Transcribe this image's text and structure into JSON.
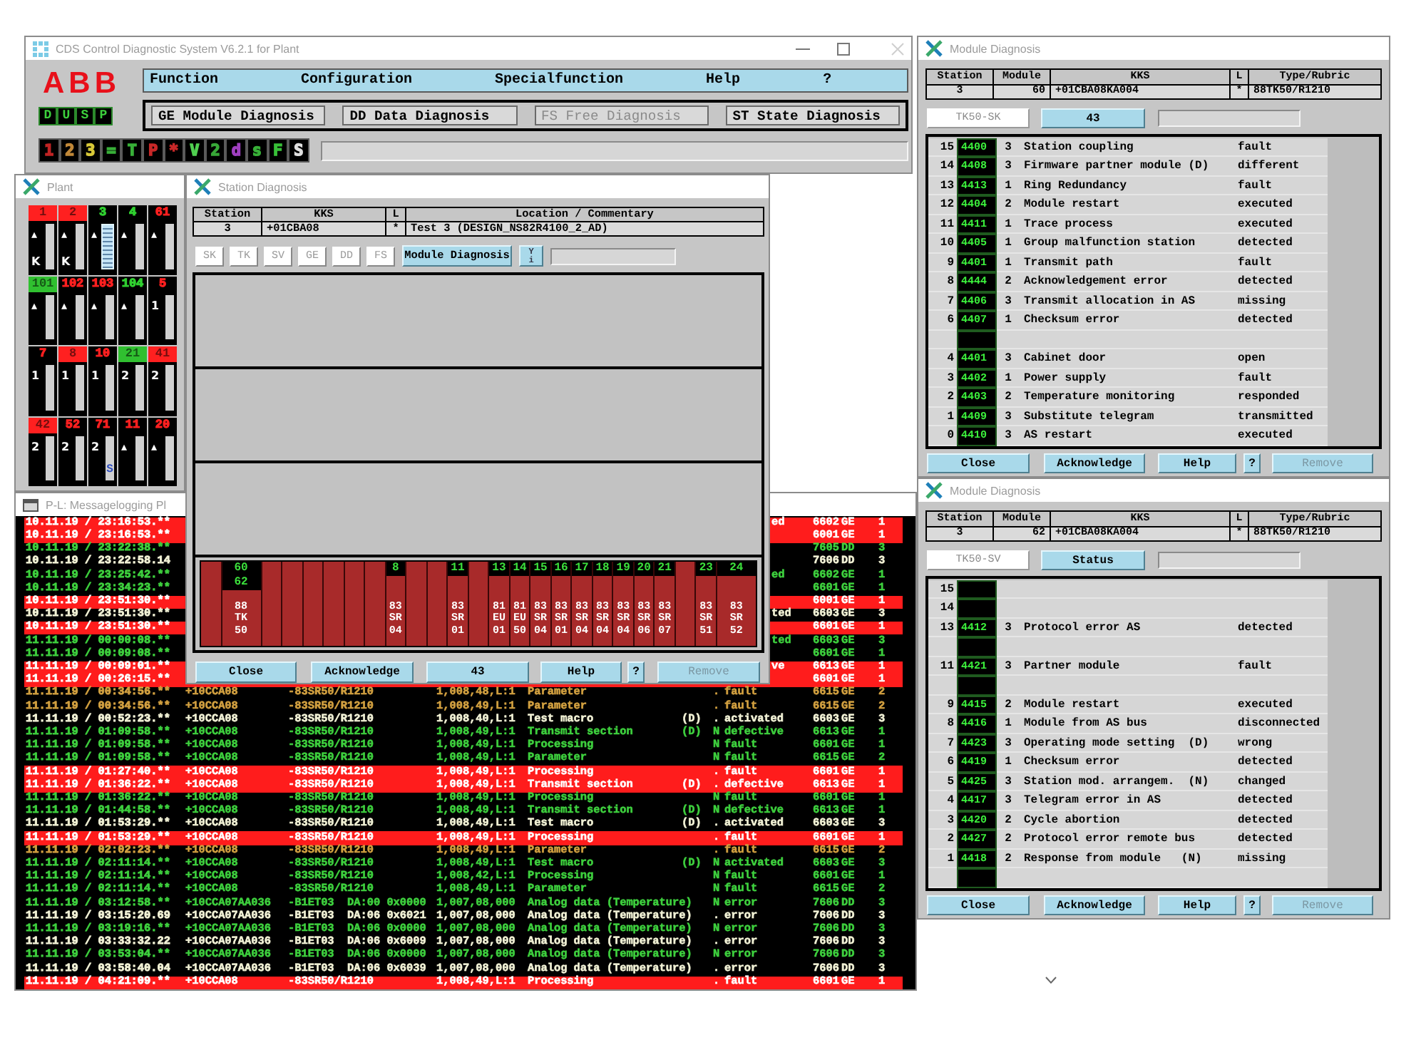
{
  "main_window": {
    "title": "CDS Control Diagnostic System V6.2.1 for Plant",
    "logo": "ABB",
    "mode_keys": [
      "D",
      "U",
      "S",
      "P"
    ],
    "menu": [
      "Function",
      "Configuration",
      "Specialfunction",
      "Help",
      "?"
    ],
    "tabs": [
      {
        "label": "GE Module Diagnosis",
        "disabled": false
      },
      {
        "label": "DD Data Diagnosis",
        "disabled": false
      },
      {
        "label": "FS Free Diagnosis",
        "disabled": true
      },
      {
        "label": "ST State Diagnosis",
        "disabled": false
      }
    ],
    "filter_keys": [
      {
        "label": "1",
        "color": "#c02424"
      },
      {
        "label": "2",
        "color": "#c08838"
      },
      {
        "label": "3",
        "color": "#d8c838"
      },
      {
        "label": "=",
        "color": "#38b038"
      },
      {
        "label": "T",
        "color": "#38b038"
      },
      {
        "label": "P",
        "color": "#c82828"
      },
      {
        "label": "*",
        "color": "#c82828"
      },
      {
        "label": "V",
        "color": "#50d050"
      },
      {
        "label": "2",
        "color": "#38a838"
      },
      {
        "label": "d",
        "color": "#a040c0"
      },
      {
        "label": "s",
        "color": "#38b038"
      },
      {
        "label": "F",
        "color": "#38c038"
      },
      {
        "label": "S",
        "color": "#e0e0e0"
      }
    ]
  },
  "plant_window": {
    "title": "Plant",
    "racks": [
      {
        "label": "1",
        "color": "#ff2020",
        "filled": true,
        "marks": [
          "▴",
          "K"
        ],
        "selected": false
      },
      {
        "label": "2",
        "color": "#ff2020",
        "filled": true,
        "marks": [
          "▴",
          "K"
        ],
        "selected": false
      },
      {
        "label": "3",
        "color": "#30d030",
        "filled": false,
        "marks": [
          "▴"
        ],
        "selected": true
      },
      {
        "label": "4",
        "color": "#30d030",
        "filled": false,
        "marks": [
          "▴"
        ],
        "selected": false
      },
      {
        "label": "61",
        "color": "#ff2020",
        "filled": false,
        "marks": [
          "▴"
        ],
        "selected": false
      },
      {
        "label": "101",
        "color": "#30c030",
        "filled": true,
        "marks": [
          "▴"
        ],
        "selected": false
      },
      {
        "label": "102",
        "color": "#ff2020",
        "filled": false,
        "marks": [
          "▴"
        ],
        "selected": false
      },
      {
        "label": "103",
        "color": "#ff2020",
        "filled": false,
        "marks": [
          "▴"
        ],
        "selected": false
      },
      {
        "label": "104",
        "color": "#30d030",
        "filled": false,
        "marks": [
          "▴"
        ],
        "selected": false
      },
      {
        "label": "5",
        "color": "#ff2020",
        "filled": false,
        "marks": [
          "1"
        ],
        "selected": false
      },
      {
        "label": "7",
        "color": "#ff2020",
        "filled": false,
        "marks": [
          "1"
        ],
        "selected": false
      },
      {
        "label": "8",
        "color": "#ff2020",
        "filled": true,
        "marks": [
          "1"
        ],
        "selected": false
      },
      {
        "label": "10",
        "color": "#ff2020",
        "filled": false,
        "marks": [
          "1"
        ],
        "selected": false
      },
      {
        "label": "21",
        "color": "#30c030",
        "filled": true,
        "marks": [
          "2"
        ],
        "selected": false
      },
      {
        "label": "41",
        "color": "#ff2020",
        "filled": true,
        "marks": [
          "2"
        ],
        "selected": false
      },
      {
        "label": "42",
        "color": "#ff2020",
        "filled": true,
        "marks": [
          "2"
        ],
        "selected": false
      },
      {
        "label": "52",
        "color": "#ff2020",
        "filled": false,
        "marks": [
          "2"
        ],
        "selected": false
      },
      {
        "label": "71",
        "color": "#ff2020",
        "filled": false,
        "marks": [
          "2"
        ],
        "selected": false,
        "bar_label": "S"
      },
      {
        "label": "11",
        "color": "#ff2020",
        "filled": false,
        "marks": [
          "▴"
        ],
        "selected": false
      },
      {
        "label": "20",
        "color": "#ff2020",
        "filled": false,
        "marks": [
          "▴"
        ],
        "selected": false
      }
    ]
  },
  "log_window": {
    "title": "P-L: Messagelogging Pl",
    "rows": [
      {
        "date": "10.11.19 / 23:16:53.**",
        "tail": "ed",
        "code": "6602",
        "type": "GE",
        "priority": "1",
        "color": "#ffffff",
        "highlighted": true
      },
      {
        "date": "10.11.19 / 23:16:53.**",
        "code": "6001",
        "type": "GE",
        "priority": "1",
        "color": "#ffffff",
        "highlighted": true
      },
      {
        "date": "10.11.19 / 23:22:38.**",
        "code": "7605",
        "type": "DD",
        "priority": "3",
        "color": "#3ed03e",
        "highlighted": false
      },
      {
        "date": "10.11.19 / 23:22:58.14",
        "code": "7606",
        "type": "DD",
        "priority": "3",
        "color": "#f2f2d6",
        "highlighted": false
      },
      {
        "date": "10.11.19 / 23:25:42.**",
        "tail": "ed",
        "code": "6602",
        "type": "GE",
        "priority": "1",
        "color": "#3ed03e",
        "highlighted": false
      },
      {
        "date": "10.11.19 / 23:34:23.**",
        "code": "6601",
        "type": "GE",
        "priority": "1",
        "color": "#3ed03e",
        "highlighted": false
      },
      {
        "date": "10.11.19 / 23:51:30.**",
        "code": "6001",
        "type": "GE",
        "priority": "1",
        "color": "#ffffff",
        "highlighted": true
      },
      {
        "date": "10.11.19 / 23:51:30.**",
        "tail": "ted",
        "code": "6603",
        "type": "GE",
        "priority": "3",
        "color": "#f2f2d6",
        "highlighted": false
      },
      {
        "date": "10.11.19 / 23:51:30.**",
        "code": "6601",
        "type": "GE",
        "priority": "1",
        "color": "#ffffff",
        "highlighted": true
      },
      {
        "date": "11.11.19 / 00:00:08.**",
        "tail": "ted",
        "code": "6603",
        "type": "GE",
        "priority": "3",
        "color": "#3ed03e",
        "highlighted": false
      },
      {
        "date": "11.11.19 / 00:09:08.**",
        "code": "6601",
        "type": "GE",
        "priority": "1",
        "color": "#3ed03e",
        "highlighted": false
      },
      {
        "date": "11.11.19 / 00:09:01.**",
        "tail": "ve",
        "code": "6613",
        "type": "GE",
        "priority": "1",
        "color": "#ffffff",
        "highlighted": true
      },
      {
        "date": "11.11.19 / 00:26:15.**",
        "code": "6601",
        "type": "GE",
        "priority": "1",
        "color": "#ffffff",
        "highlighted": true
      },
      {
        "date": "11.11.19 / 00:34:56.**",
        "kks": "+10CCA08",
        "module": "-83SR50/R1210",
        "address": "1,008,48,L:1",
        "text": "Parameter",
        "mark": ".",
        "status": "fault",
        "code": "6615",
        "type": "GE",
        "priority": "2",
        "color": "#d2a040",
        "highlighted": false
      },
      {
        "date": "11.11.19 / 00:34:56.**",
        "kks": "+10CCA08",
        "module": "-83SR50/R1210",
        "address": "1,008,49,L:1",
        "text": "Parameter",
        "mark": ".",
        "status": "fault",
        "code": "6615",
        "type": "GE",
        "priority": "2",
        "color": "#d2a040",
        "highlighted": false
      },
      {
        "date": "11.11.19 / 00:52:23.**",
        "kks": "+10CCA08",
        "module": "-83SR50/R1210",
        "address": "1,008,40,L:1",
        "text": "Test macro",
        "flag": "(D)",
        "mark": ".",
        "status": "activated",
        "code": "6603",
        "type": "GE",
        "priority": "3",
        "color": "#f2f2d6",
        "highlighted": false
      },
      {
        "date": "11.11.19 / 01:09:58.**",
        "kks": "+10CCA08",
        "module": "-83SR50/R1210",
        "address": "1,008,49,L:1",
        "text": "Transmit section",
        "flag": "(D)",
        "mark": "N",
        "status": "defective",
        "code": "6613",
        "type": "GE",
        "priority": "1",
        "color": "#3ed03e",
        "highlighted": false
      },
      {
        "date": "11.11.19 / 01:09:58.**",
        "kks": "+10CCA08",
        "module": "-83SR50/R1210",
        "address": "1,008,49,L:1",
        "text": "Processing",
        "mark": "N",
        "status": "fault",
        "code": "6601",
        "type": "GE",
        "priority": "1",
        "color": "#3ed03e",
        "highlighted": false
      },
      {
        "date": "11.11.19 / 01:09:58.**",
        "kks": "+10CCA08",
        "module": "-83SR50/R1210",
        "address": "1,008,49,L:1",
        "text": "Parameter",
        "mark": "N",
        "status": "fault",
        "code": "6615",
        "type": "GE",
        "priority": "2",
        "color": "#3ed03e",
        "highlighted": false
      },
      {
        "date": "11.11.19 / 01:27:40.**",
        "kks": "+10CCA08",
        "module": "-83SR50/R1210",
        "address": "1,008,49,L:1",
        "text": "Processing",
        "mark": ".",
        "status": "fault",
        "code": "6601",
        "type": "GE",
        "priority": "1",
        "color": "#ffffff",
        "highlighted": true
      },
      {
        "date": "11.11.19 / 01:36:22.**",
        "kks": "+10CCA08",
        "module": "-83SR50/R1210",
        "address": "1,008,49,L:1",
        "text": "Transmit section",
        "flag": "(D)",
        "mark": ".",
        "status": "defective",
        "code": "6613",
        "type": "GE",
        "priority": "1",
        "color": "#ffffff",
        "highlighted": true
      },
      {
        "date": "11.11.19 / 01:36:22.**",
        "kks": "+10CCA08",
        "module": "-83SR50/R1210",
        "address": "1,008,49,L:1",
        "text": "Processing",
        "mark": "N",
        "status": "fault",
        "code": "6601",
        "type": "GE",
        "priority": "1",
        "color": "#3ed03e",
        "highlighted": false
      },
      {
        "date": "11.11.19 / 01:44:58.**",
        "kks": "+10CCA08",
        "module": "-83SR50/R1210",
        "address": "1,008,49,L:1",
        "text": "Transmit section",
        "flag": "(D)",
        "mark": "N",
        "status": "defective",
        "code": "6613",
        "type": "GE",
        "priority": "1",
        "color": "#3ed03e",
        "highlighted": false
      },
      {
        "date": "11.11.19 / 01:53:29.**",
        "kks": "+10CCA08",
        "module": "-83SR50/R1210",
        "address": "1,008,49,L:1",
        "text": "Test macro",
        "flag": "(D)",
        "mark": ".",
        "status": "activated",
        "code": "6603",
        "type": "GE",
        "priority": "3",
        "color": "#f2f2d6",
        "highlighted": false
      },
      {
        "date": "11.11.19 / 01:53:29.**",
        "kks": "+10CCA08",
        "module": "-83SR50/R1210",
        "address": "1,008,49,L:1",
        "text": "Processing",
        "mark": ".",
        "status": "fault",
        "code": "6601",
        "type": "GE",
        "priority": "1",
        "color": "#ffffff",
        "highlighted": true
      },
      {
        "date": "11.11.19 / 02:02:23.**",
        "kks": "+10CCA08",
        "module": "-83SR50/R1210",
        "address": "1,008,49,L:1",
        "text": "Parameter",
        "mark": ".",
        "status": "fault",
        "code": "6615",
        "type": "GE",
        "priority": "2",
        "color": "#d2a040",
        "highlighted": false
      },
      {
        "date": "11.11.19 / 02:11:14.**",
        "kks": "+10CCA08",
        "module": "-83SR50/R1210",
        "address": "1,008,49,L:1",
        "text": "Test macro",
        "flag": "(D)",
        "mark": "N",
        "status": "activated",
        "code": "6603",
        "type": "GE",
        "priority": "3",
        "color": "#3ed03e",
        "highlighted": false
      },
      {
        "date": "11.11.19 / 02:11:14.**",
        "kks": "+10CCA08",
        "module": "-83SR50/R1210",
        "address": "1,008,42,L:1",
        "text": "Processing",
        "mark": "N",
        "status": "fault",
        "code": "6601",
        "type": "GE",
        "priority": "1",
        "color": "#3ed03e",
        "highlighted": false
      },
      {
        "date": "11.11.19 / 02:11:14.**",
        "kks": "+10CCA08",
        "module": "-83SR50/R1210",
        "address": "1,008,49,L:1",
        "text": "Parameter",
        "mark": "N",
        "status": "fault",
        "code": "6615",
        "type": "GE",
        "priority": "2",
        "color": "#3ed03e",
        "highlighted": false
      },
      {
        "date": "11.11.19 / 03:12:58.**",
        "kks": "+10CCA07AA036",
        "module": "-B1ET03  DA:00 0x0000",
        "address": "1,007,08,000",
        "text": "Analog data (Temperature)",
        "mark": "N",
        "status": "error",
        "code": "7606",
        "type": "DD",
        "priority": "3",
        "color": "#3ed03e",
        "highlighted": false
      },
      {
        "date": "11.11.19 / 03:15:20.69",
        "kks": "+10CCA07AA036",
        "module": "-B1ET03  DA:06 0x6021",
        "address": "1,007,08,000",
        "text": "Analog data (Temperature)",
        "mark": ".",
        "status": "error",
        "code": "7606",
        "type": "DD",
        "priority": "3",
        "color": "#f2f2d6",
        "highlighted": false
      },
      {
        "date": "11.11.19 / 03:19:16.**",
        "kks": "+10CCA07AA036",
        "module": "-B1ET03  DA:06 0x0000",
        "address": "1,007,08,000",
        "text": "Analog data (Temperature)",
        "mark": "N",
        "status": "error",
        "code": "7606",
        "type": "DD",
        "priority": "3",
        "color": "#3ed03e",
        "highlighted": false
      },
      {
        "date": "11.11.19 / 03:33:32.22",
        "kks": "+10CCA07AA036",
        "module": "-B1ET03  DA:06 0x6009",
        "address": "1,007,08,000",
        "text": "Analog data (Temperature)",
        "mark": ".",
        "status": "error",
        "code": "7606",
        "type": "DD",
        "priority": "3",
        "color": "#f2f2d6",
        "highlighted": false
      },
      {
        "date": "11.11.19 / 03:53:04.**",
        "kks": "+10CCA07AA036",
        "module": "-B1ET03  DA:06 0x0000",
        "address": "1,007,08,000",
        "text": "Analog data (Temperature)",
        "mark": "N",
        "status": "error",
        "code": "7606",
        "type": "DD",
        "priority": "3",
        "color": "#3ed03e",
        "highlighted": false
      },
      {
        "date": "11.11.19 / 03:58:40.04",
        "kks": "+10CCA07AA036",
        "module": "-B1ET03  DA:06 0x6039",
        "address": "1,007,08,000",
        "text": "Analog data (Temperature)",
        "mark": ".",
        "status": "error",
        "code": "7606",
        "type": "DD",
        "priority": "3",
        "color": "#f2f2d6",
        "highlighted": false
      },
      {
        "date": "11.11.19 / 04:21:09.**",
        "kks": "+10CCA08",
        "module": "-83SR50/R1210",
        "address": "1,008,49,L:1",
        "text": "Processing",
        "mark": ".",
        "status": "fault",
        "code": "6601",
        "type": "GE",
        "priority": "1",
        "color": "#ffffff",
        "highlighted": true
      }
    ]
  },
  "station_window": {
    "title": "Station Diagnosis",
    "columns": [
      "Station",
      "KKS",
      "L",
      "Location / Commentary"
    ],
    "values": [
      "3",
      "+01CBA08",
      "*",
      "Test 3 (DESIGN_NS82R4100_2_AD)"
    ],
    "view_buttons": [
      {
        "label": "SK",
        "disabled": true
      },
      {
        "label": "TK",
        "disabled": true
      },
      {
        "label": "SV",
        "disabled": true
      },
      {
        "label": "GE",
        "disabled": true
      },
      {
        "label": "DD",
        "disabled": true
      },
      {
        "label": "FS",
        "disabled": true
      }
    ],
    "module_button": "Module Diagnosis",
    "toggle": "Y i",
    "slots": [
      {
        "kind": "empty"
      },
      {
        "kind": "module",
        "numbers": [
          "60",
          "62"
        ],
        "type": "88 TK 50",
        "wide": true
      },
      {
        "kind": "empty"
      },
      {
        "kind": "empty"
      },
      {
        "kind": "empty"
      },
      {
        "kind": "empty"
      },
      {
        "kind": "empty"
      },
      {
        "kind": "empty"
      },
      {
        "kind": "module",
        "numbers": [
          "8"
        ],
        "type": "83 SR 04",
        "wide": false
      },
      {
        "kind": "empty"
      },
      {
        "kind": "empty"
      },
      {
        "kind": "module",
        "numbers": [
          "11"
        ],
        "type": "83 SR 01",
        "wide": false
      },
      {
        "kind": "empty"
      },
      {
        "kind": "module",
        "numbers": [
          "13"
        ],
        "type": "81 EU 01",
        "wide": false
      },
      {
        "kind": "module",
        "numbers": [
          "14"
        ],
        "type": "81 EU 50",
        "wide": false
      },
      {
        "kind": "module",
        "numbers": [
          "15"
        ],
        "type": "83 SR 04",
        "wide": false
      },
      {
        "kind": "module",
        "numbers": [
          "16"
        ],
        "type": "83 SR 01",
        "wide": false
      },
      {
        "kind": "module",
        "numbers": [
          "17"
        ],
        "type": "83 SR 04",
        "wide": false
      },
      {
        "kind": "module",
        "numbers": [
          "18"
        ],
        "type": "83 SR 04",
        "wide": false
      },
      {
        "kind": "module",
        "numbers": [
          "19"
        ],
        "type": "83 SR 04",
        "wide": false
      },
      {
        "kind": "module",
        "numbers": [
          "20"
        ],
        "type": "83 SR 06",
        "wide": false
      },
      {
        "kind": "module",
        "numbers": [
          "21"
        ],
        "type": "83 SR 07",
        "wide": false
      },
      {
        "kind": "empty"
      },
      {
        "kind": "module",
        "numbers": [
          "23"
        ],
        "type": "83 SR 51",
        "wide": false
      },
      {
        "kind": "module",
        "numbers": [
          "24"
        ],
        "type": "83 SR 52",
        "wide": true
      }
    ],
    "buttons": [
      {
        "kind": "close",
        "label": "Close",
        "disabled": false
      },
      {
        "kind": "acknowledge",
        "label": "Acknowledge",
        "disabled": false
      },
      {
        "kind": "count",
        "label": "43",
        "disabled": false
      },
      {
        "kind": "help",
        "label": "Help",
        "disabled": false
      },
      {
        "kind": "question",
        "label": "?",
        "disabled": false
      },
      {
        "kind": "remove",
        "label": "Remove",
        "disabled": true
      }
    ]
  },
  "module_windows": [
    {
      "title": "Module Diagnosis",
      "columns": [
        "Station",
        "Module",
        "KKS",
        "L",
        "Type/Rubric"
      ],
      "values": [
        "3",
        "60",
        "+01CBA08KA004",
        "*",
        "88TK50/R1210"
      ],
      "name_field": "TK50-SK",
      "action_button": "43",
      "events": [
        {
          "kind": "event",
          "slot": "15",
          "code": "4400",
          "priority": "3",
          "text": "Station coupling",
          "state": "fault"
        },
        {
          "kind": "event",
          "slot": "14",
          "code": "4408",
          "priority": "3",
          "text": "Firmware partner module (D)",
          "state": "different"
        },
        {
          "kind": "event",
          "slot": "13",
          "code": "4413",
          "priority": "1",
          "text": "Ring Redundancy",
          "state": "fault"
        },
        {
          "kind": "event",
          "slot": "12",
          "code": "4404",
          "priority": "2",
          "text": "Module restart",
          "state": "executed"
        },
        {
          "kind": "event",
          "slot": "11",
          "code": "4411",
          "priority": "1",
          "text": "Trace process",
          "state": "executed"
        },
        {
          "kind": "event",
          "slot": "10",
          "code": "4405",
          "priority": "1",
          "text": "Group malfunction station",
          "state": "detected"
        },
        {
          "kind": "event",
          "slot": "9",
          "code": "4401",
          "priority": "1",
          "text": "Transmit path",
          "state": "fault"
        },
        {
          "kind": "event",
          "slot": "8",
          "code": "4444",
          "priority": "2",
          "text": "Acknowledgement error",
          "state": "detected"
        },
        {
          "kind": "event",
          "slot": "7",
          "code": "4406",
          "priority": "3",
          "text": "Transmit allocation in AS",
          "state": "missing"
        },
        {
          "kind": "event",
          "slot": "6",
          "code": "4407",
          "priority": "1",
          "text": "Checksum error",
          "state": "detected"
        },
        {
          "kind": "empty"
        },
        {
          "kind": "event",
          "slot": "4",
          "code": "4401",
          "priority": "3",
          "text": "Cabinet door",
          "state": "open"
        },
        {
          "kind": "event",
          "slot": "3",
          "code": "4402",
          "priority": "1",
          "text": "Power supply",
          "state": "fault"
        },
        {
          "kind": "event",
          "slot": "2",
          "code": "4403",
          "priority": "2",
          "text": "Temperature monitoring",
          "state": "responded"
        },
        {
          "kind": "event",
          "slot": "1",
          "code": "4409",
          "priority": "3",
          "text": "Substitute telegram",
          "state": "transmitted"
        },
        {
          "kind": "event",
          "slot": "0",
          "code": "4410",
          "priority": "3",
          "text": "AS restart",
          "state": "executed"
        }
      ],
      "buttons": [
        {
          "kind": "close",
          "label": "Close",
          "disabled": false
        },
        {
          "kind": "acknowledge",
          "label": "Acknowledge",
          "disabled": false
        },
        {
          "kind": "help",
          "label": "Help",
          "disabled": false
        },
        {
          "kind": "question",
          "label": "?",
          "disabled": false
        },
        {
          "kind": "remove",
          "label": "Remove",
          "disabled": true
        }
      ]
    },
    {
      "title": "Module Diagnosis",
      "columns": [
        "Station",
        "Module",
        "KKS",
        "L",
        "Type/Rubric"
      ],
      "values": [
        "3",
        "62",
        "+01CBA08KA004",
        "*",
        "88TK50/R1210"
      ],
      "name_field": "TK50-SV",
      "action_button": "Status",
      "events": [
        {
          "kind": "empty",
          "slot": "15"
        },
        {
          "kind": "empty",
          "slot": "14"
        },
        {
          "kind": "event",
          "slot": "13",
          "code": "4412",
          "priority": "3",
          "text": "Protocol error AS",
          "state": "detected"
        },
        {
          "kind": "empty"
        },
        {
          "kind": "event",
          "slot": "11",
          "code": "4421",
          "priority": "3",
          "text": "Partner module",
          "state": "fault"
        },
        {
          "kind": "empty"
        },
        {
          "kind": "event",
          "slot": "9",
          "code": "4415",
          "priority": "2",
          "text": "Module restart",
          "state": "executed"
        },
        {
          "kind": "event",
          "slot": "8",
          "code": "4416",
          "priority": "1",
          "text": "Module from AS bus",
          "state": "disconnected"
        },
        {
          "kind": "event",
          "slot": "7",
          "code": "4423",
          "priority": "3",
          "text": "Operating mode setting  (D)",
          "state": "wrong"
        },
        {
          "kind": "event",
          "slot": "6",
          "code": "4419",
          "priority": "1",
          "text": "Checksum error",
          "state": "detected"
        },
        {
          "kind": "event",
          "slot": "5",
          "code": "4425",
          "priority": "3",
          "text": "Station mod. arrangem.  (N)",
          "state": "changed"
        },
        {
          "kind": "event",
          "slot": "4",
          "code": "4417",
          "priority": "3",
          "text": "Telegram error in AS",
          "state": "detected"
        },
        {
          "kind": "event",
          "slot": "3",
          "code": "4420",
          "priority": "2",
          "text": "Cycle abortion",
          "state": "detected"
        },
        {
          "kind": "event",
          "slot": "2",
          "code": "4427",
          "priority": "2",
          "text": "Protocol error remote bus",
          "state": "detected"
        },
        {
          "kind": "event",
          "slot": "1",
          "code": "4418",
          "priority": "2",
          "text": "Response from module   (N)",
          "state": "missing"
        },
        {
          "kind": "empty"
        }
      ],
      "buttons": [
        {
          "kind": "close",
          "label": "Close",
          "disabled": false
        },
        {
          "kind": "acknowledge",
          "label": "Acknowledge",
          "disabled": false
        },
        {
          "kind": "help",
          "label": "Help",
          "disabled": false
        },
        {
          "kind": "question",
          "label": "?",
          "disabled": false
        },
        {
          "kind": "remove",
          "label": "Remove",
          "disabled": true
        }
      ]
    }
  ]
}
